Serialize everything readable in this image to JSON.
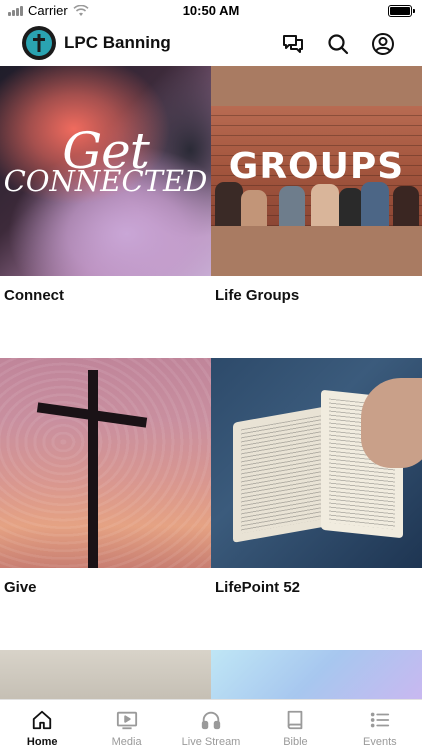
{
  "status_bar": {
    "carrier": "Carrier",
    "time": "10:50 AM"
  },
  "header": {
    "app_title": "LPC Banning",
    "icons": [
      "chat-icon",
      "search-icon",
      "profile-icon"
    ]
  },
  "tiles": [
    {
      "label": "Connect",
      "image_text_line1": "Get",
      "image_text_line2": "CONNECTED"
    },
    {
      "label": "Life Groups",
      "image_text": "GROUPS"
    },
    {
      "label": "Give"
    },
    {
      "label": "LifePoint 52"
    }
  ],
  "tabbar": {
    "tabs": [
      {
        "label": "Home",
        "icon": "home-icon",
        "active": true
      },
      {
        "label": "Media",
        "icon": "media-icon",
        "active": false
      },
      {
        "label": "Live Stream",
        "icon": "headphones-icon",
        "active": false
      },
      {
        "label": "Bible",
        "icon": "book-icon",
        "active": false
      },
      {
        "label": "Events",
        "icon": "list-icon",
        "active": false
      }
    ]
  },
  "colors": {
    "accent": "#111111",
    "inactive": "#9a9a9a",
    "logo_teal": "#2aa3b1"
  }
}
